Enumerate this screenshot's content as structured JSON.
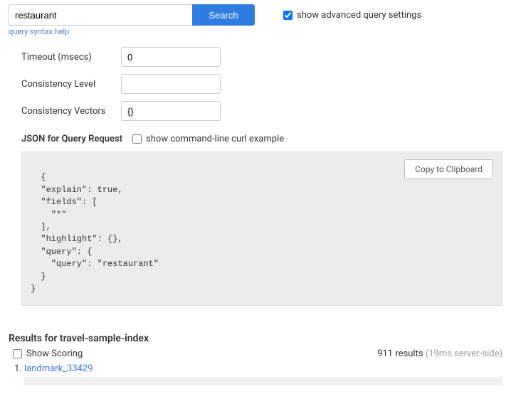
{
  "search": {
    "query": "restaurant",
    "button_label": "Search",
    "advanced_checkbox_label": "show advanced query settings",
    "advanced_checked": true,
    "help_link": "query syntax help"
  },
  "advanced": {
    "timeout_label": "Timeout (msecs)",
    "timeout_value": "0",
    "consistency_level_label": "Consistency Level",
    "consistency_level_value": "",
    "consistency_vectors_label": "Consistency Vectors",
    "consistency_vectors_value": "{}"
  },
  "json_section": {
    "title": "JSON for Query Request",
    "curl_label": "show command-line curl example",
    "curl_checked": false,
    "copy_label": "Copy to Clipboard",
    "body": "{\n  \"explain\": true,\n  \"fields\": [\n    \"*\"\n  ],\n  \"highlight\": {},\n  \"query\": {\n    \"query\": \"restaurant\"\n  }\n}"
  },
  "results": {
    "heading": "Results for travel-sample-index",
    "show_scoring_label": "Show Scoring",
    "show_scoring_checked": false,
    "count_text": "911 results",
    "timing_text": "(19ms server-side)",
    "items": [
      {
        "num": "1.",
        "label": "landmark_33429"
      }
    ]
  }
}
